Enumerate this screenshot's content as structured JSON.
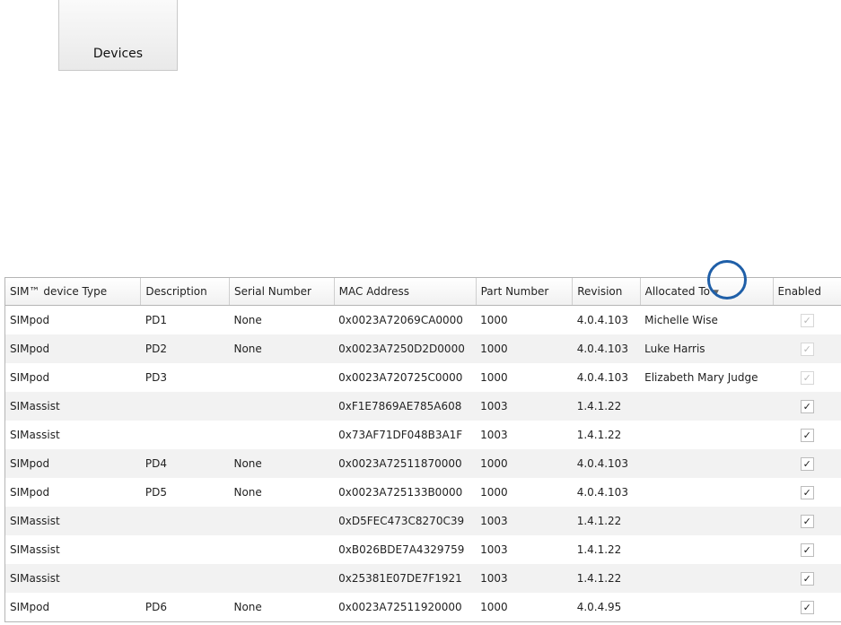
{
  "toolbar": {
    "devices_label": "Devices"
  },
  "table": {
    "columns": [
      "SIM™ device Type",
      "Description",
      "Serial Number",
      "MAC Address",
      "Part Number",
      "Revision",
      "Allocated To",
      "Enabled"
    ],
    "sort_indicator": "▼",
    "rows": [
      {
        "type": "SIMpod",
        "desc": "PD1",
        "serial": "None",
        "mac": "0x0023A72069CA0000",
        "part": "1000",
        "rev": "4.0.4.103",
        "alloc": "Michelle Wise",
        "enabled": true,
        "enabled_state": "disabled"
      },
      {
        "type": "SIMpod",
        "desc": "PD2",
        "serial": "None",
        "mac": "0x0023A7250D2D0000",
        "part": "1000",
        "rev": "4.0.4.103",
        "alloc": "Luke Harris",
        "enabled": true,
        "enabled_state": "disabled"
      },
      {
        "type": "SIMpod",
        "desc": "PD3",
        "serial": "",
        "mac": "0x0023A720725C0000",
        "part": "1000",
        "rev": "4.0.4.103",
        "alloc": "Elizabeth Mary Judge",
        "enabled": true,
        "enabled_state": "disabled"
      },
      {
        "type": "SIMassist",
        "desc": "",
        "serial": "",
        "mac": "0xF1E7869AE785A608",
        "part": "1003",
        "rev": "1.4.1.22",
        "alloc": "",
        "enabled": true,
        "enabled_state": "active"
      },
      {
        "type": "SIMassist",
        "desc": "",
        "serial": "",
        "mac": "0x73AF71DF048B3A1F",
        "part": "1003",
        "rev": "1.4.1.22",
        "alloc": "",
        "enabled": true,
        "enabled_state": "active"
      },
      {
        "type": "SIMpod",
        "desc": "PD4",
        "serial": "None",
        "mac": "0x0023A72511870000",
        "part": "1000",
        "rev": "4.0.4.103",
        "alloc": "",
        "enabled": true,
        "enabled_state": "active"
      },
      {
        "type": "SIMpod",
        "desc": "PD5",
        "serial": "None",
        "mac": "0x0023A725133B0000",
        "part": "1000",
        "rev": "4.0.4.103",
        "alloc": "",
        "enabled": true,
        "enabled_state": "active"
      },
      {
        "type": "SIMassist",
        "desc": "",
        "serial": "",
        "mac": "0xD5FEC473C8270C39",
        "part": "1003",
        "rev": "1.4.1.22",
        "alloc": "",
        "enabled": true,
        "enabled_state": "active"
      },
      {
        "type": "SIMassist",
        "desc": "",
        "serial": "",
        "mac": "0xB026BDE7A4329759",
        "part": "1003",
        "rev": "1.4.1.22",
        "alloc": "",
        "enabled": true,
        "enabled_state": "active"
      },
      {
        "type": "SIMassist",
        "desc": "",
        "serial": "",
        "mac": "0x25381E07DE7F1921",
        "part": "1003",
        "rev": "1.4.1.22",
        "alloc": "",
        "enabled": true,
        "enabled_state": "active"
      },
      {
        "type": "SIMpod",
        "desc": "PD6",
        "serial": "None",
        "mac": "0x0023A72511920000",
        "part": "1000",
        "rev": "4.0.4.95",
        "alloc": "",
        "enabled": true,
        "enabled_state": "active"
      }
    ]
  },
  "colors": {
    "highlight_circle": "#1f5fa8",
    "alt_row": "#f2f2f2",
    "border": "#b5b5b5"
  },
  "icons": {
    "sort": "sort-descending-icon",
    "check": "checkbox-checked-icon"
  }
}
